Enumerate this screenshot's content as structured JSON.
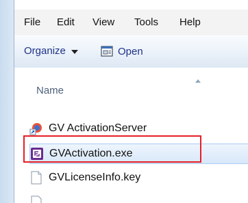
{
  "menu": [
    "File",
    "Edit",
    "View",
    "Tools",
    "Help"
  ],
  "toolbar": {
    "organize_label": "Organize",
    "open_label": "Open"
  },
  "columns": {
    "name_header": "Name"
  },
  "files": [
    {
      "name": "GV ActivationServer",
      "icon": "shortcut-icon"
    },
    {
      "name": "GVActivation.exe",
      "icon": "exe-icon",
      "selected": true
    },
    {
      "name": "GVLicenseInfo.key",
      "icon": "document-icon"
    }
  ],
  "colors": {
    "highlight": "#e51e26",
    "selection": "#d8e8f9",
    "toolbar_text": "#1e3287"
  }
}
